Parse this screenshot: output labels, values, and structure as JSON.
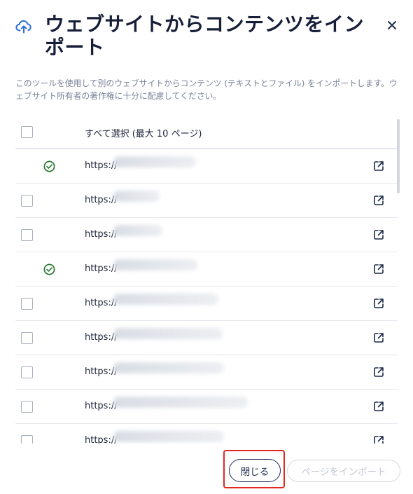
{
  "dialog": {
    "title": "ウェブサイトからコンテンツをインポート",
    "icon": "upload-cloud-icon",
    "close_icon": "close-icon",
    "description": "このツールを使用して別のウェブサイトからコンテンツ (テキストとファイル) をインポートします。ウェブサイト所有者の著作権に十分に配慮してください。"
  },
  "list": {
    "select_all_label": "すべて選択 (最大 10 ページ)",
    "rows": [
      {
        "url": "https://",
        "status": "imported"
      },
      {
        "url": "https://",
        "status": "unchecked"
      },
      {
        "url": "https://",
        "status": "unchecked"
      },
      {
        "url": "https://",
        "status": "imported"
      },
      {
        "url": "https://",
        "status": "unchecked"
      },
      {
        "url": "https://",
        "status": "unchecked"
      },
      {
        "url": "https://",
        "status": "unchecked"
      },
      {
        "url": "https://",
        "status": "unchecked"
      },
      {
        "url": "https://",
        "status": "unchecked"
      }
    ]
  },
  "footer": {
    "close_label": "閉じる",
    "import_label": "ページをインポート"
  },
  "colors": {
    "title": "#161e38",
    "check_green": "#2a7a2e",
    "highlight": "#e3261f",
    "primary_outline": "#1d2a50"
  }
}
